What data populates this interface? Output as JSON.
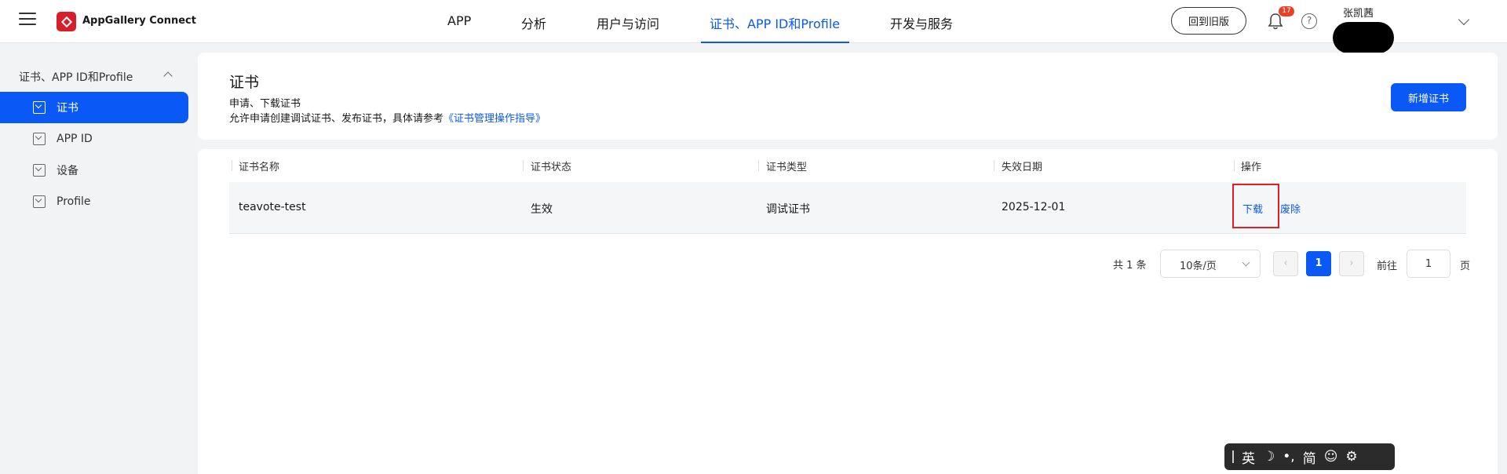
{
  "header": {
    "brand": "AppGallery Connect",
    "nav": [
      "APP",
      "分析",
      "用户与访问",
      "证书、APP ID和Profile",
      "开发与服务"
    ],
    "old_version_button": "回到旧版",
    "notification_count": "17",
    "help_symbol": "?",
    "user_name": "张凯茜"
  },
  "sidebar": {
    "section_title": "证书、APP ID和Profile",
    "items": [
      {
        "label": "证书",
        "active": true
      },
      {
        "label": "APP ID",
        "active": false
      },
      {
        "label": "设备",
        "active": false
      },
      {
        "label": "Profile",
        "active": false
      }
    ]
  },
  "main": {
    "title": "证书",
    "subtitle": "申请、下载证书",
    "description": "允许申请创建调试证书、发布证书，具体请参考",
    "guide_link": "《证书管理操作指导》",
    "new_button": "新增证书"
  },
  "table": {
    "columns": [
      "证书名称",
      "证书状态",
      "证书类型",
      "失效日期",
      "操作"
    ],
    "rows": [
      {
        "name": "teavote-test",
        "status": "生效",
        "type": "调试证书",
        "expiry": "2025-12-01",
        "actions": [
          "下载",
          "废除"
        ]
      }
    ]
  },
  "pagination": {
    "total": "共 1 条",
    "page_size": "10条/页",
    "prev_symbol": "‹",
    "next_symbol": "›",
    "current_page": "1",
    "goto_label": "前往",
    "goto_value": "1",
    "page_label": "页"
  },
  "ime_toolbar": {
    "items": [
      "英",
      "☽",
      "•,",
      "简",
      "☺",
      "⚙"
    ]
  },
  "colors": {
    "accent": "#0a59f7",
    "brand_red": "#d71f2b",
    "highlight_red": "#e02020"
  }
}
